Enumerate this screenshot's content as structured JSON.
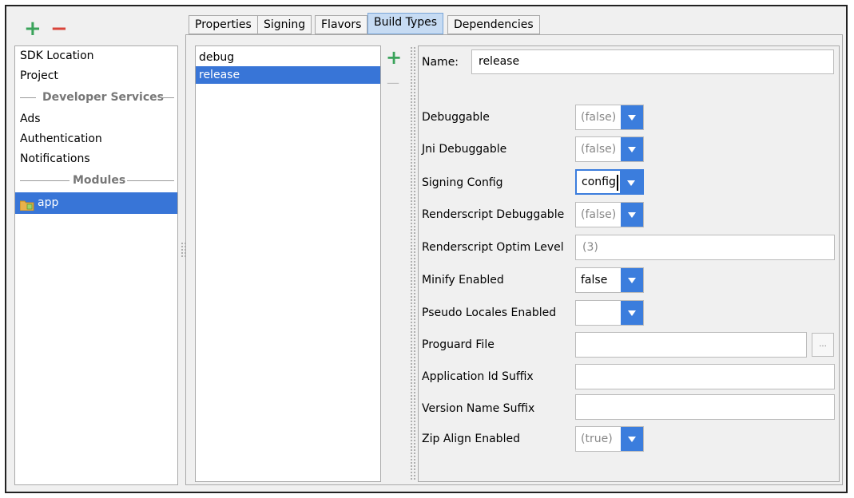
{
  "toolbar": {
    "add_icon": "+",
    "remove_icon": "−"
  },
  "sidebar": {
    "items": [
      "SDK Location",
      "Project"
    ],
    "developer_services_header": "Developer Services",
    "developer_services": [
      "Ads",
      "Authentication",
      "Notifications"
    ],
    "modules_header": "Modules",
    "modules": [
      "app"
    ]
  },
  "tabs": [
    "Properties",
    "Signing",
    "Flavors",
    "Build Types",
    "Dependencies"
  ],
  "active_tab": "Build Types",
  "build_types": [
    "debug",
    "release"
  ],
  "selected_build_type": "release",
  "list_tools": {
    "add": "+",
    "remove": "—"
  },
  "form": {
    "name_label": "Name:",
    "name_value": "release",
    "fields": {
      "debuggable": {
        "label": "Debuggable",
        "value": "(false)"
      },
      "jni_debuggable": {
        "label": "Jni Debuggable",
        "value": "(false)"
      },
      "signing_config": {
        "label": "Signing Config",
        "value": "config"
      },
      "renderscript_debuggable": {
        "label": "Renderscript Debuggable",
        "value": "(false)"
      },
      "renderscript_optim_level": {
        "label": "Renderscript Optim Level",
        "value": "(3)"
      },
      "minify_enabled": {
        "label": "Minify Enabled",
        "value": "false"
      },
      "pseudo_locales_enabled": {
        "label": "Pseudo Locales Enabled",
        "value": ""
      },
      "proguard_file": {
        "label": "Proguard File",
        "value": "",
        "browse": "..."
      },
      "application_id_suffix": {
        "label": "Application Id Suffix",
        "value": ""
      },
      "version_name_suffix": {
        "label": "Version Name Suffix",
        "value": ""
      },
      "zip_align_enabled": {
        "label": "Zip Align Enabled",
        "value": "(true)"
      }
    }
  },
  "colors": {
    "selection": "#3875d7",
    "combo_arrow": "#3b7ddd",
    "add": "#3aa35a",
    "remove": "#d9443a",
    "active_tab": "#c6dbf3"
  },
  "icons": {
    "module": "android-module-folder-icon"
  }
}
